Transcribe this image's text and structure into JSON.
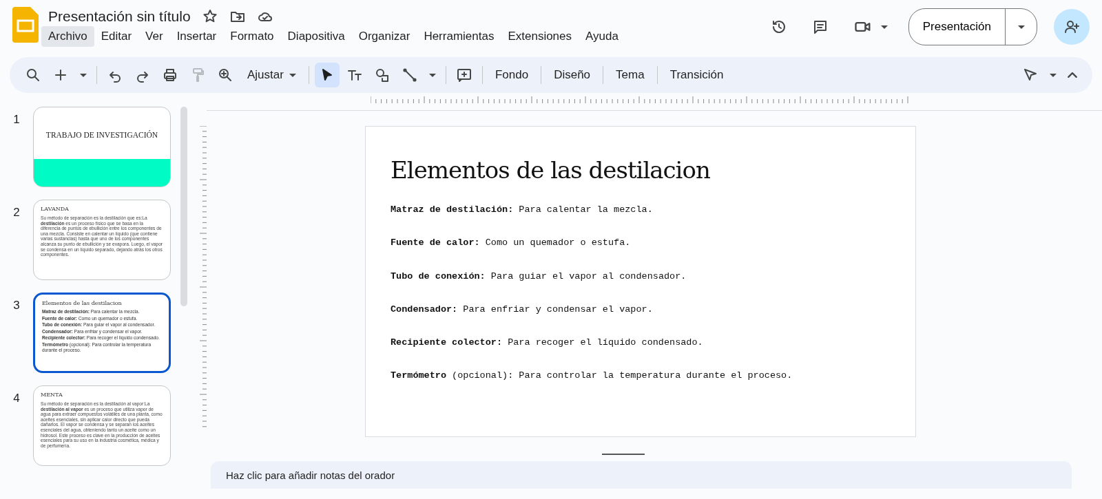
{
  "app": {
    "title": "Presentación sin título",
    "menu": [
      {
        "label": "Archivo",
        "selected": true
      },
      {
        "label": "Editar",
        "selected": false
      },
      {
        "label": "Ver",
        "selected": false
      },
      {
        "label": "Insertar",
        "selected": false
      },
      {
        "label": "Formato",
        "selected": false
      },
      {
        "label": "Diapositiva",
        "selected": false
      },
      {
        "label": "Organizar",
        "selected": false
      },
      {
        "label": "Herramientas",
        "selected": false
      },
      {
        "label": "Extensiones",
        "selected": false
      },
      {
        "label": "Ayuda",
        "selected": false
      }
    ],
    "present_button": "Presentación"
  },
  "toolbar": {
    "tools": [
      {
        "kind": "search",
        "disabled": false
      },
      {
        "kind": "add",
        "disabled": false
      },
      {
        "kind": "undo",
        "disabled": false
      },
      {
        "kind": "redo",
        "disabled": false
      },
      {
        "kind": "print",
        "disabled": false
      },
      {
        "kind": "paint",
        "disabled": true
      },
      {
        "kind": "zoom",
        "disabled": false
      }
    ],
    "zoom_label": "Ajustar",
    "drawing_tools": [
      {
        "kind": "select",
        "selected": true
      },
      {
        "kind": "text",
        "selected": false
      },
      {
        "kind": "shape",
        "selected": false
      },
      {
        "kind": "line",
        "selected": false
      }
    ],
    "text_buttons": [
      "Fondo",
      "Diseño",
      "Tema",
      "Transición"
    ]
  },
  "slides": [
    {
      "number": "1",
      "selected": false,
      "kind": "title",
      "title": "TRABAJO DE INVESTIGACIÓN"
    },
    {
      "number": "2",
      "selected": false,
      "kind": "text",
      "title": "LAVANDA",
      "body": "Su método de separación es la destilación que es:La **destilación** es un proceso físico que se basa en la diferencia de puntos de ebullición entre los componentes de una mezcla. Consiste en calentar un líquido (que contiene varias sustancias) hasta que uno de los componentes alcanza su punto de ebullición y se evapora. Luego, el vapor se condensa en un líquido separado, dejando atrás los otros componentes."
    },
    {
      "number": "3",
      "selected": true,
      "kind": "list",
      "title": "Elementos de las destilacion",
      "items": [
        "**Matraz de destilación:** Para calentar la mezcla.",
        "**Fuente de calor:** Como un quemador o estufa.",
        "**Tubo de conexión:** Para guiar el vapor al condensador.",
        "**Condensador:** Para enfriar y condensar el vapor.",
        "**Recipiente colector:** Para recoger el líquido condensado.",
        "**Termómetro** (opcional): Para controlar la temperatura durante el proceso."
      ]
    },
    {
      "number": "4",
      "selected": false,
      "kind": "text",
      "title": "MENTA",
      "body": "Su método de separación es la destilación al vapor:La **destilación al vapor** es un proceso que utiliza vapor de agua para extraer compuestos volátiles de una planta, como aceites esenciales, sin aplicar calor directo que pueda dañarlos. El vapor se condensa y se separan los aceites esenciales del agua, obteniendo tanto un aceite como un hidrosol. Este proceso es clave en la producción de aceites esenciales para su uso en la industria cosmética, médica y de perfumería."
    }
  ],
  "editor": {
    "title": "Elementos de las destilacion",
    "items": [
      "**Matraz de destilación:** Para calentar la mezcla.",
      "**Fuente de calor:** Como un quemador o estufa.",
      "**Tubo de conexión:** Para guiar el vapor al condensador.",
      "**Condensador:** Para enfriar y condensar el vapor.",
      "**Recipiente colector:** Para recoger el líquido condensado.",
      "**Termómetro** (opcional): Para controlar la temperatura durante el proceso."
    ]
  },
  "notes": {
    "placeholder": "Haz clic para añadir notas del orador"
  }
}
